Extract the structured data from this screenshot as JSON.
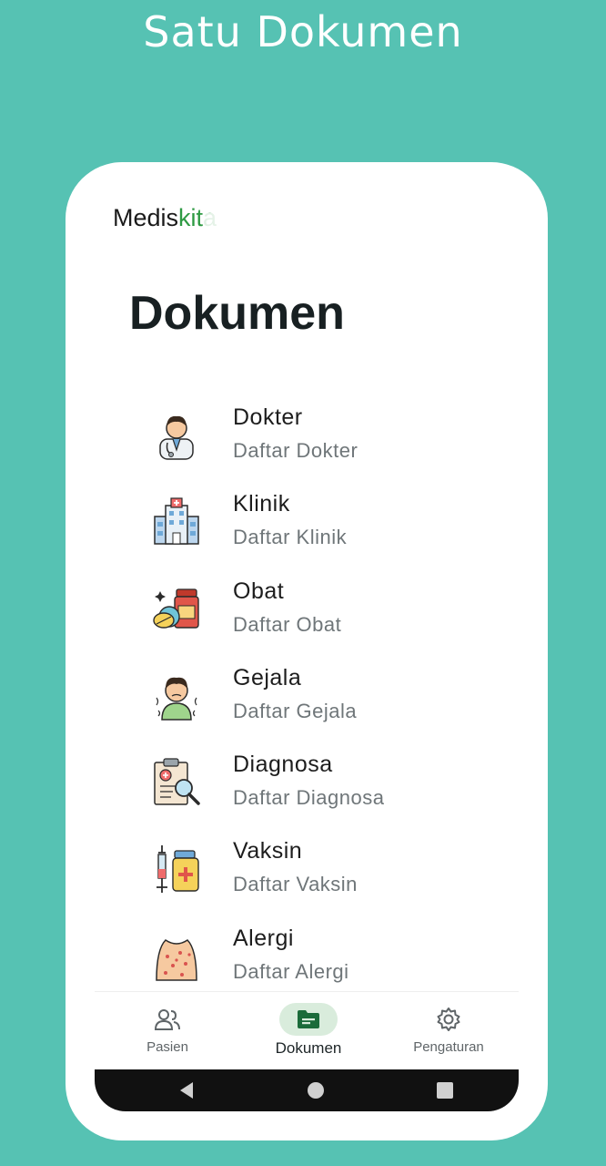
{
  "headline": "Satu Dokumen",
  "app": {
    "brand_prefix": "Medis",
    "brand_suffix": "kita",
    "accent": "#2e9a43"
  },
  "page": {
    "title": "Dokumen"
  },
  "items": [
    {
      "title": "Dokter",
      "subtitle": "Daftar Dokter",
      "icon": "doctor-icon"
    },
    {
      "title": "Klinik",
      "subtitle": "Daftar Klinik",
      "icon": "clinic-icon"
    },
    {
      "title": "Obat",
      "subtitle": "Daftar Obat",
      "icon": "medicine-icon"
    },
    {
      "title": "Gejala",
      "subtitle": "Daftar Gejala",
      "icon": "symptom-icon"
    },
    {
      "title": "Diagnosa",
      "subtitle": "Daftar Diagnosa",
      "icon": "diagnosis-icon"
    },
    {
      "title": "Vaksin",
      "subtitle": "Daftar Vaksin",
      "icon": "vaccine-icon"
    },
    {
      "title": "Alergi",
      "subtitle": "Daftar Alergi",
      "icon": "allergy-icon"
    }
  ],
  "nav": [
    {
      "label": "Pasien",
      "icon": "people-icon",
      "active": false
    },
    {
      "label": "Dokumen",
      "icon": "folder-icon",
      "active": true
    },
    {
      "label": "Pengaturan",
      "icon": "gear-icon",
      "active": false
    }
  ],
  "colors": {
    "background": "#56c2b3",
    "active_nav": "#d9ecdc",
    "icon_dark": "#1b6b3a"
  }
}
